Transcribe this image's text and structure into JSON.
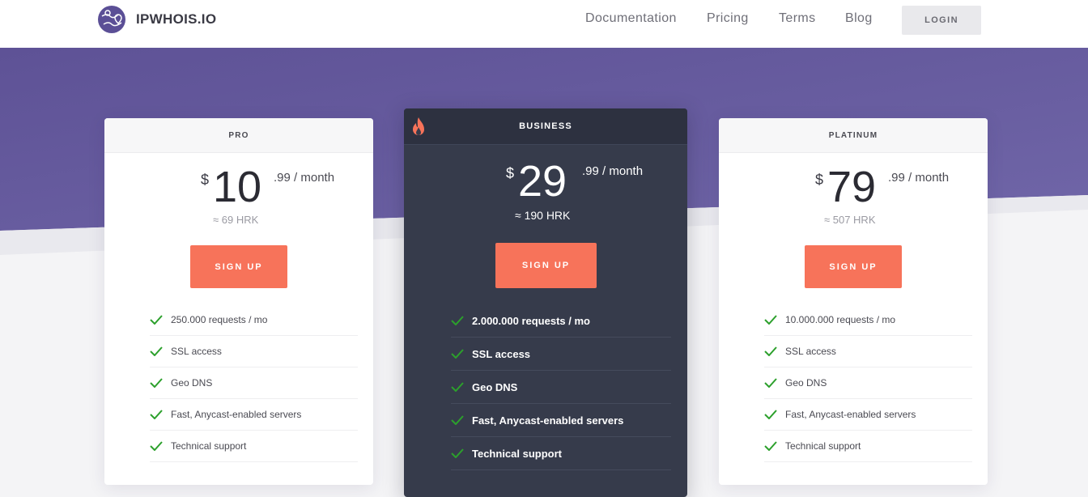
{
  "header": {
    "brand": "IPWHOIS.IO",
    "logo_icon": "globe-pin-icon",
    "nav": [
      "Documentation",
      "Pricing",
      "Terms",
      "Blog"
    ],
    "login_label": "LOGIN"
  },
  "colors": {
    "hero_purple": "#66599c",
    "accent_orange": "#f7735a",
    "featured_dark": "#363b4b",
    "check_green": "#2ca02c"
  },
  "plans": [
    {
      "name": "PRO",
      "currency": "$",
      "amount": "10",
      "cents_period": ".99 / month",
      "local_price": "≈ 69 HRK",
      "cta": "SIGN UP",
      "features": [
        "250.000 requests / mo",
        "SSL access",
        "Geo DNS",
        "Fast, Anycast-enabled servers",
        "Technical support"
      ]
    },
    {
      "name": "BUSINESS",
      "featured_icon": "flame-icon",
      "currency": "$",
      "amount": "29",
      "cents_period": ".99 / month",
      "local_price": "≈ 190 HRK",
      "cta": "SIGN UP",
      "features": [
        "2.000.000 requests / mo",
        "SSL access",
        "Geo DNS",
        "Fast, Anycast-enabled servers",
        "Technical support"
      ]
    },
    {
      "name": "PLATINUM",
      "currency": "$",
      "amount": "79",
      "cents_period": ".99 / month",
      "local_price": "≈ 507 HRK",
      "cta": "SIGN UP",
      "features": [
        "10.000.000 requests / mo",
        "SSL access",
        "Geo DNS",
        "Fast, Anycast-enabled servers",
        "Technical support"
      ]
    }
  ]
}
